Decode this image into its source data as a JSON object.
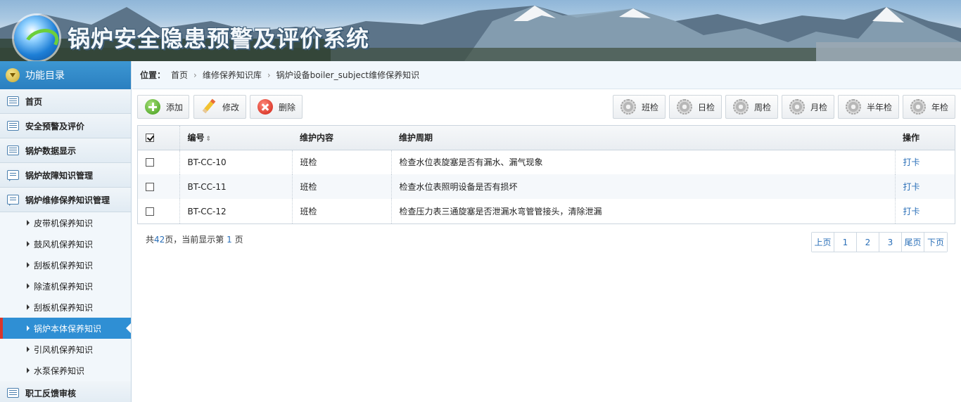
{
  "header": {
    "title": "锅炉安全隐患预警及评价系统"
  },
  "sidebar": {
    "heading": "功能目录",
    "items": [
      {
        "label": "首页",
        "icon": "list-icon"
      },
      {
        "label": "安全预警及评价",
        "icon": "list-icon"
      },
      {
        "label": "锅炉数据显示",
        "icon": "list-icon"
      },
      {
        "label": "锅炉故障知识管理",
        "icon": "chat-icon"
      },
      {
        "label": "锅炉维修保养知识管理",
        "icon": "chat-icon"
      }
    ],
    "subitems": [
      {
        "label": "皮带机保养知识"
      },
      {
        "label": "鼓风机保养知识"
      },
      {
        "label": "刮板机保养知识"
      },
      {
        "label": "除渣机保养知识"
      },
      {
        "label": "刮板机保养知识"
      },
      {
        "label": "锅炉本体保养知识",
        "active": true
      },
      {
        "label": "引风机保养知识"
      },
      {
        "label": "水泵保养知识"
      }
    ],
    "last_item": {
      "label": "职工反馈审核",
      "icon": "list-icon"
    }
  },
  "breadcrumb": {
    "prefix": "位置：",
    "items": [
      "首页",
      "维修保养知识库",
      "锅炉设备boiler_subject维修保养知识"
    ]
  },
  "toolbar": {
    "add": "添加",
    "edit": "修改",
    "delete": "删除",
    "filters": [
      "班检",
      "日检",
      "周检",
      "月检",
      "半年检",
      "年检"
    ]
  },
  "table": {
    "columns": [
      "编号",
      "维护内容",
      "维护周期",
      "操作"
    ],
    "rows": [
      {
        "id": "BT-CC-10",
        "content": "班检",
        "cycle": "检查水位表旋塞是否有漏水、漏气现象",
        "action": "打卡",
        "checked": false
      },
      {
        "id": "BT-CC-11",
        "content": "班检",
        "cycle": "检查水位表照明设备是否有损坏",
        "action": "打卡",
        "checked": false
      },
      {
        "id": "BT-CC-12",
        "content": "班检",
        "cycle": "检查压力表三通旋塞是否泄漏水弯管管接头，清除泄漏",
        "action": "打卡",
        "checked": false
      }
    ],
    "header_checked": true
  },
  "footer": {
    "prefix": "共",
    "total_pages": "42",
    "middle": "页，当前显示第",
    "current_page": "1",
    "suffix": "页"
  },
  "pager": {
    "prev": "上页",
    "pages": [
      "1",
      "2",
      "3"
    ],
    "last": "尾页",
    "next": "下页"
  }
}
